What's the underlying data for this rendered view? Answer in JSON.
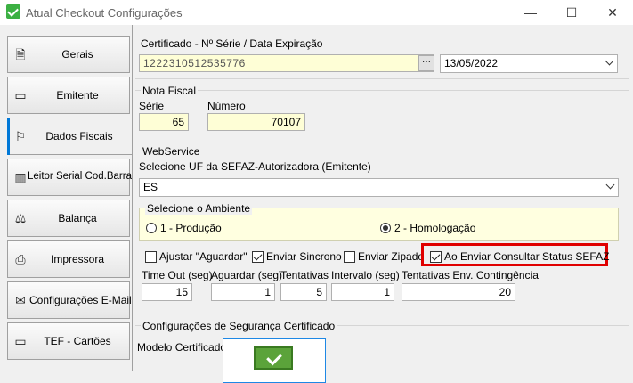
{
  "window": {
    "title": "Atual Checkout Configurações",
    "minimize": "—",
    "maximize": "☐",
    "close": "✕"
  },
  "sidebar": {
    "items": [
      {
        "label": "Gerais",
        "icon": "document-icon",
        "glyph": "🗎"
      },
      {
        "label": "Emitente",
        "icon": "card-icon",
        "glyph": "▭"
      },
      {
        "label": "Dados Fiscais",
        "icon": "flag-icon",
        "glyph": "⚐",
        "active": true
      },
      {
        "label": "Leitor Serial Cod.Barra",
        "icon": "barcode-icon",
        "glyph": "▥"
      },
      {
        "label": "Balança",
        "icon": "scale-icon",
        "glyph": "⚖"
      },
      {
        "label": "Impressora",
        "icon": "printer-icon",
        "glyph": "⎙"
      },
      {
        "label": "Configurações E-Mail",
        "icon": "mail-icon",
        "glyph": "✉"
      },
      {
        "label": "TEF - Cartões",
        "icon": "card-icon",
        "glyph": "▭"
      }
    ]
  },
  "certificado": {
    "group_title": "Certificado - Nº Série / Data Expiração",
    "serial_value": "1222310512535776",
    "browse_label": "···",
    "date_value": "13/05/2022"
  },
  "nota_fiscal": {
    "group_title": "Nota Fiscal",
    "serie_label": "Série",
    "serie_value": "65",
    "numero_label": "Número",
    "numero_value": "70107"
  },
  "webservice": {
    "group_title": "WebService",
    "uf_label": "Selecione UF da SEFAZ-Autorizadora (Emitente)",
    "uf_value": "ES",
    "ambiente_title": "Selecione o Ambiente",
    "ambiente_producao": "1 - Produção",
    "ambiente_homologacao": "2 - Homologação",
    "ambiente_selected": "2 - Homologação",
    "checkboxes": {
      "ajustar_label": "Ajustar \"Aguardar\"",
      "ajustar_checked": false,
      "sincrono_label": "Enviar Sincrono",
      "sincrono_checked": true,
      "zipado_label": "Enviar Zipado",
      "zipado_checked": false,
      "consultar_label": "Ao Enviar Consultar Status SEFAZ",
      "consultar_checked": true
    },
    "timeout_label": "Time Out (seg)",
    "timeout_value": "15",
    "aguardar_label": "Aguardar (seg)",
    "aguardar_value": "1",
    "tentativas_label": "Tentativas",
    "tentativas_value": "5",
    "intervalo_label": "Intervalo (seg)",
    "intervalo_value": "1",
    "contingencia_label": "Tentativas Env. Contingência",
    "contingencia_value": "20"
  },
  "seguranca": {
    "group_title": "Configurações de Segurança Certificado",
    "modelo_label": "Modelo Certificado"
  },
  "colors": {
    "highlight": "#e00000",
    "accent": "#0078d7",
    "field_yellow": "#fefed6"
  }
}
